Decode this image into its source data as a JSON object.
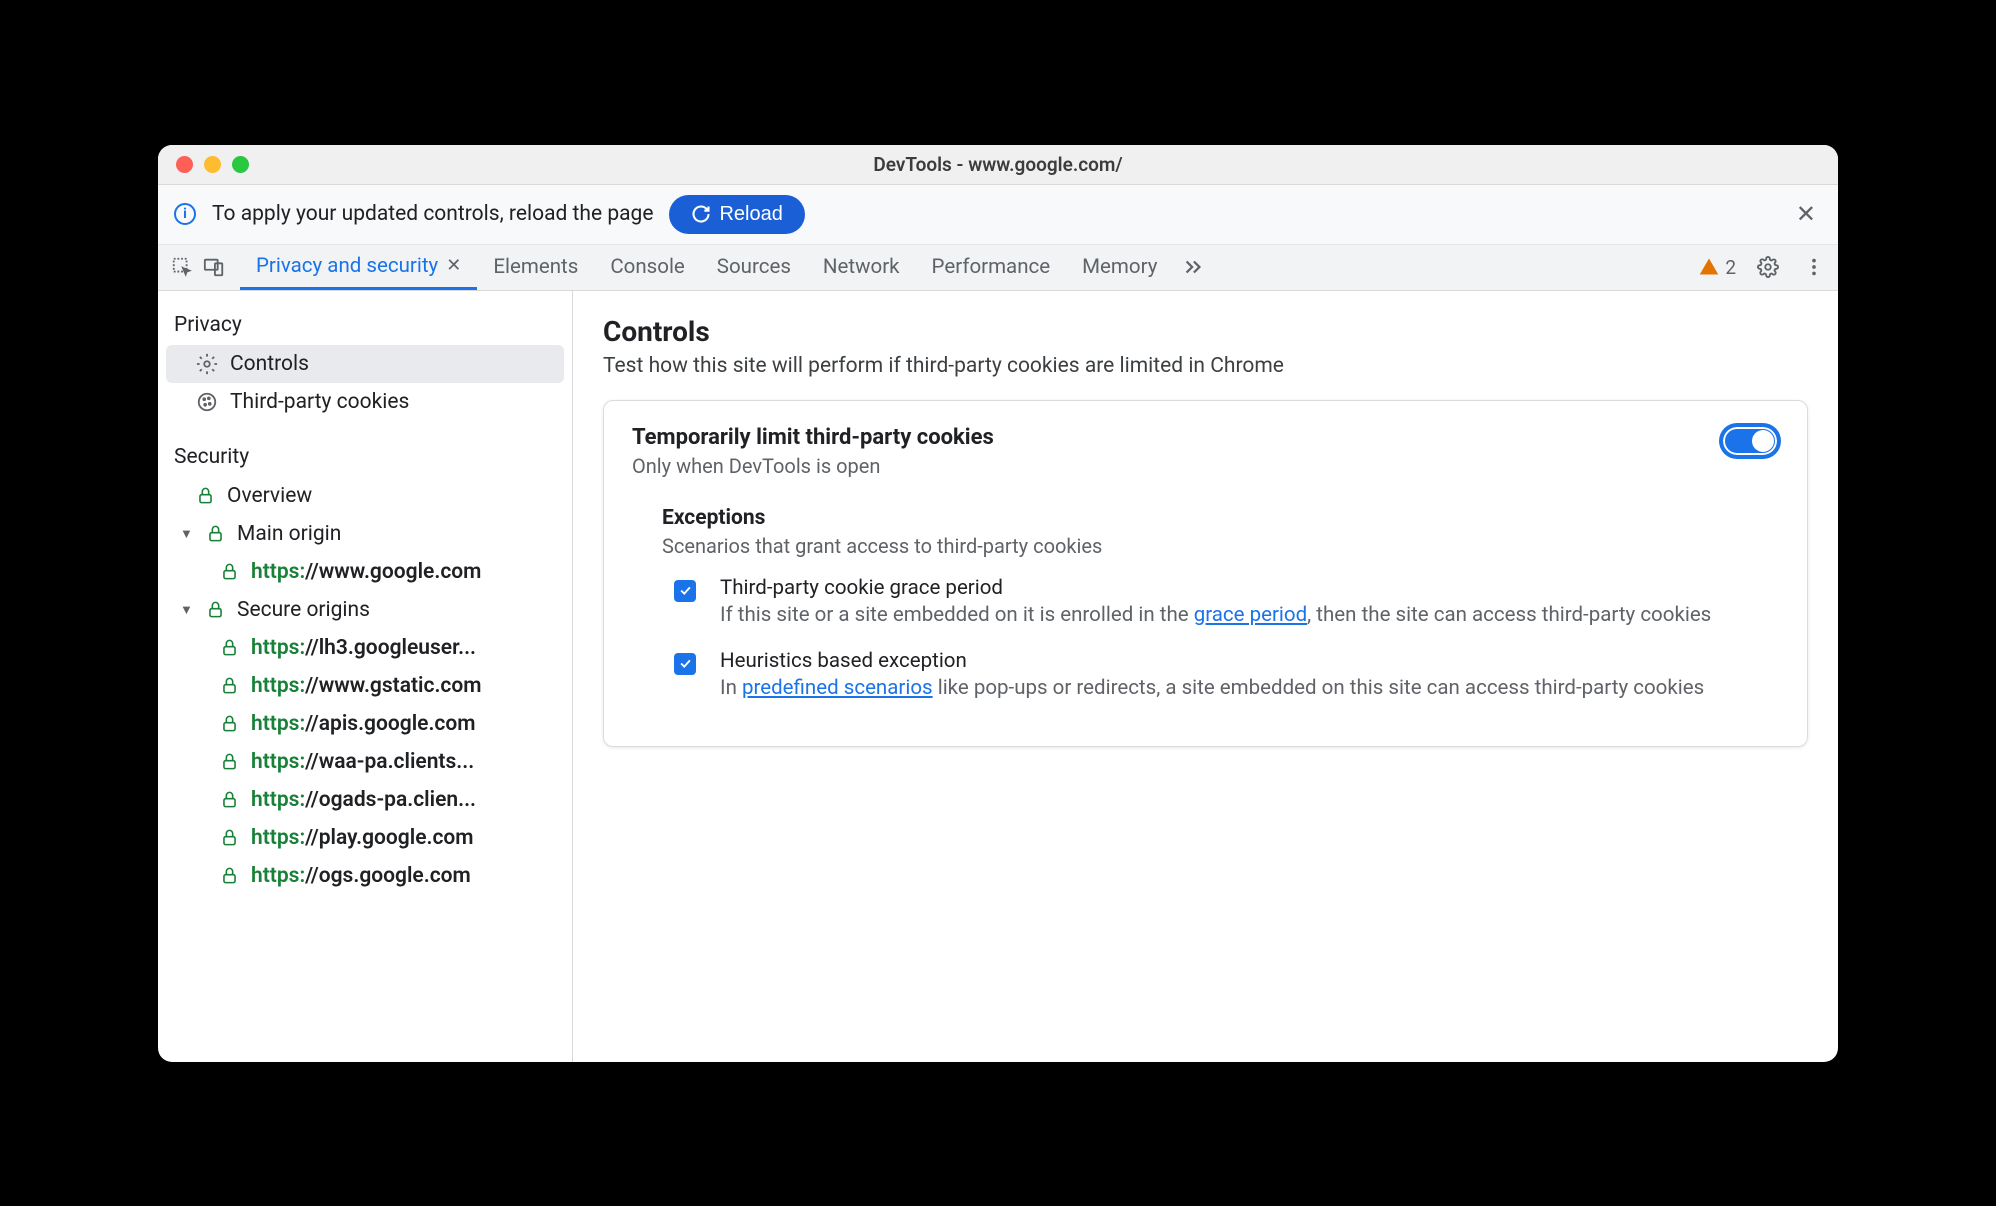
{
  "window": {
    "title": "DevTools - www.google.com/"
  },
  "infobar": {
    "text": "To apply your updated controls, reload the page",
    "reload_label": "Reload"
  },
  "tabs": {
    "active": "Privacy and security",
    "items": [
      "Privacy and security",
      "Elements",
      "Console",
      "Sources",
      "Network",
      "Performance",
      "Memory"
    ]
  },
  "warnings": {
    "count": "2"
  },
  "sidebar": {
    "privacy": {
      "heading": "Privacy",
      "items": [
        {
          "label": "Controls",
          "icon": "gear",
          "selected": true
        },
        {
          "label": "Third-party cookies",
          "icon": "cookie",
          "selected": false
        }
      ]
    },
    "security": {
      "heading": "Security",
      "overview": "Overview",
      "main_origin_label": "Main origin",
      "main_origin": {
        "scheme": "https:",
        "rest": "//www.google.com"
      },
      "secure_origins_label": "Secure origins",
      "secure_origins": [
        {
          "scheme": "https:",
          "rest": "//lh3.googleuser..."
        },
        {
          "scheme": "https:",
          "rest": "//www.gstatic.com"
        },
        {
          "scheme": "https:",
          "rest": "//apis.google.com"
        },
        {
          "scheme": "https:",
          "rest": "//waa-pa.clients..."
        },
        {
          "scheme": "https:",
          "rest": "//ogads-pa.clien..."
        },
        {
          "scheme": "https:",
          "rest": "//play.google.com"
        },
        {
          "scheme": "https:",
          "rest": "//ogs.google.com"
        }
      ]
    }
  },
  "main": {
    "title": "Controls",
    "subtitle": "Test how this site will perform if third-party cookies are limited in Chrome",
    "card": {
      "title": "Temporarily limit third-party cookies",
      "subtitle": "Only when DevTools is open",
      "toggle_on": true,
      "exceptions": {
        "heading": "Exceptions",
        "sub": "Scenarios that grant access to third-party cookies",
        "items": [
          {
            "title": "Third-party cookie grace period",
            "desc_prefix": "If this site or a site embedded on it is enrolled in the ",
            "link_text": "grace period",
            "desc_suffix": ", then the site can access third-party cookies",
            "checked": true
          },
          {
            "title": "Heuristics based exception",
            "desc_prefix": "In ",
            "link_text": "predefined scenarios",
            "desc_suffix": " like pop-ups or redirects, a site embedded on this site can access third-party cookies",
            "checked": true
          }
        ]
      }
    }
  }
}
